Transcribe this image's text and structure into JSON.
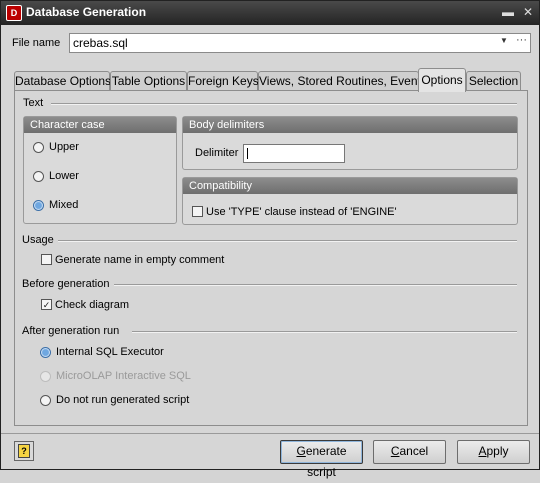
{
  "window": {
    "title": "Database Generation",
    "icon_letter": "D",
    "minimize_glyph": "▬",
    "close_glyph": "✕"
  },
  "file": {
    "label": "File name",
    "value": "crebas.sql",
    "dropdown_glyph": "▼",
    "browse_glyph": "···"
  },
  "tabs": [
    {
      "label": "Database Options"
    },
    {
      "label": "Table Options"
    },
    {
      "label": "Foreign Keys"
    },
    {
      "label": "Views, Stored Routines, Events"
    },
    {
      "label": "Options",
      "active": true
    },
    {
      "label": "Selection"
    }
  ],
  "text_section": {
    "title": "Text",
    "character_case": {
      "title": "Character case",
      "options": [
        {
          "label": "Upper",
          "selected": false
        },
        {
          "label": "Lower",
          "selected": false
        },
        {
          "label": "Mixed",
          "selected": true
        }
      ]
    },
    "body_delimiters": {
      "title": "Body delimiters",
      "delimiter_label": "Delimiter",
      "delimiter_value": ""
    },
    "compatibility": {
      "title": "Compatibility",
      "type_clause_label": "Use 'TYPE' clause instead of 'ENGINE'",
      "type_clause_checked": false
    }
  },
  "usage": {
    "title": "Usage",
    "generate_name_label": "Generate name in empty comment",
    "generate_name_checked": false
  },
  "before_generation": {
    "title": "Before generation",
    "check_diagram_label": "Check diagram",
    "check_diagram_checked": true
  },
  "after_generation": {
    "title": "After generation run",
    "options": [
      {
        "label": "Internal SQL Executor",
        "selected": true,
        "enabled": true
      },
      {
        "label": "MicroOLAP Interactive SQL",
        "selected": false,
        "enabled": false
      },
      {
        "label": "Do not run generated script",
        "selected": false,
        "enabled": true
      }
    ]
  },
  "buttons": {
    "generate_prefix": "",
    "generate_mnemonic": "G",
    "generate_rest": "enerate script",
    "cancel_mnemonic": "C",
    "cancel_rest": "ancel",
    "apply_mnemonic": "A",
    "apply_rest": "pply",
    "help_glyph": "?"
  },
  "colors": {
    "titlebar": "#2e2e2e",
    "group_header": "#7d7d7d",
    "radio_selected": "#6fa7e0"
  }
}
